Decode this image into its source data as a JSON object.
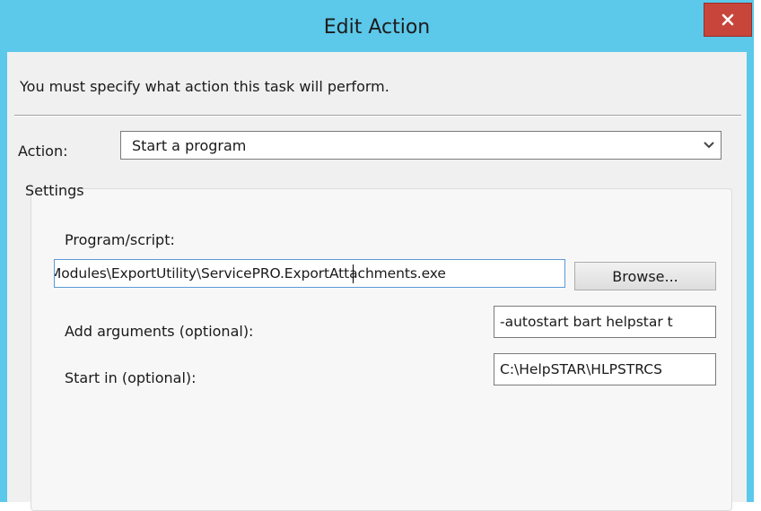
{
  "window": {
    "title": "Edit Action",
    "close_icon": "close-icon",
    "colors": {
      "titlebar": "#5cc8ea",
      "close": "#c8453b"
    }
  },
  "instruction": "You must specify what action this task will perform.",
  "action": {
    "label": "Action:",
    "value": "Start a program",
    "dropdown_icon": "chevron-down-icon"
  },
  "settings": {
    "legend": "Settings",
    "program": {
      "label": "Program/script:",
      "value": "Modules\\ExportUtility\\ServicePRO.ExportAttachments.exe",
      "browse_label": "Browse..."
    },
    "arguments": {
      "label": "Add arguments (optional):",
      "value": "-autostart bart helpstar t"
    },
    "start_in": {
      "label": "Start in (optional):",
      "value": "C:\\HelpSTAR\\HLPSTRCS"
    }
  }
}
